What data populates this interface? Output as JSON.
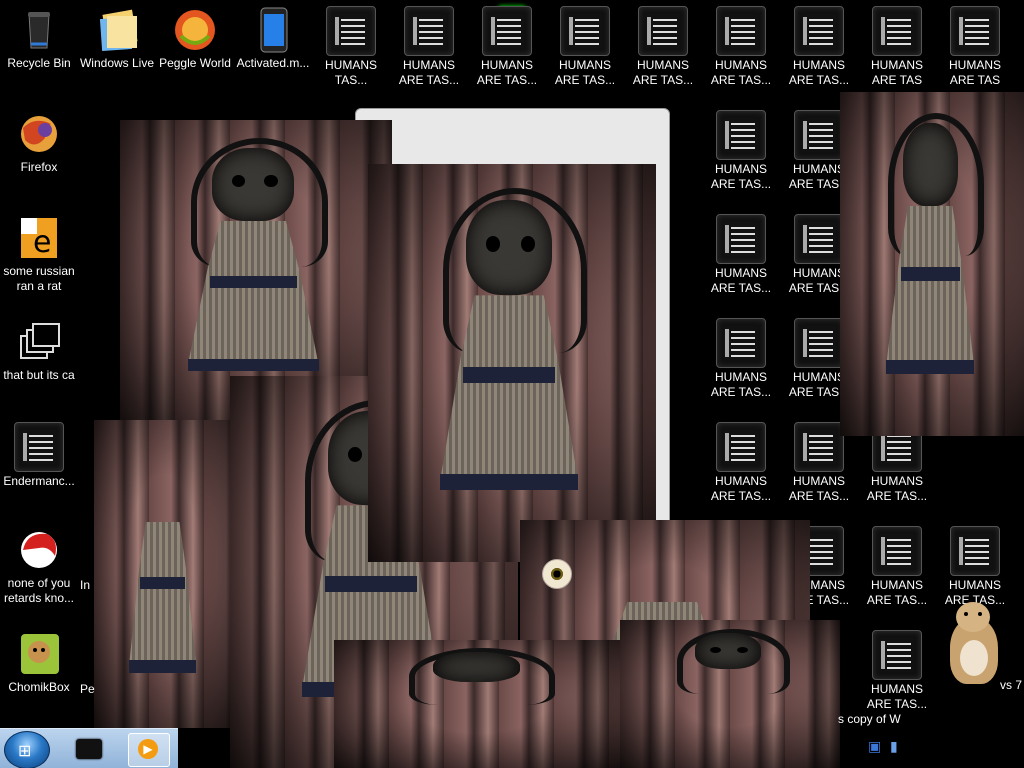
{
  "desktop": {
    "left_icons": [
      {
        "label": "Recycle Bin",
        "icon": "recycle-bin-icon"
      },
      {
        "label": "Firefox",
        "icon": "firefox-icon"
      },
      {
        "label": "some russian ran a rat",
        "icon": "shortcut-e-icon"
      },
      {
        "label": "that but its ca",
        "icon": "stacked-windows-icon"
      },
      {
        "label": "Endermanc...",
        "icon": "document-icon"
      },
      {
        "label": "none of you retards kno...",
        "icon": "firefox-red-icon"
      },
      {
        "label": "ChomikBox",
        "icon": "chomikbox-icon"
      }
    ],
    "top_icons": [
      {
        "label": "Windows Live",
        "icon": "folder-icon"
      },
      {
        "label": "Peggle World",
        "icon": "peggle-icon"
      },
      {
        "label": "Activated.m...",
        "icon": "blue-phone-icon"
      }
    ],
    "doc_label": "HUMANS ARE TAS...",
    "doc_label_short": "HUMANS ARE TAS",
    "doc_label_top_first": "HUMANS TAS...",
    "partial_labels": [
      "In",
      "Pe"
    ],
    "eyeball_icon": "eyeball-icon",
    "hamster_caption": "s copy of W",
    "hamster_caption_right": "vs 7"
  },
  "taskbar": {
    "start_label": "Start",
    "start_icon": "windows-orb-icon",
    "items": [
      {
        "name": "explorer",
        "icon": "explorer-icon"
      },
      {
        "name": "media-player",
        "icon": "media-player-icon"
      }
    ]
  },
  "tray": {
    "icons": [
      "network-icon",
      "flag-icon"
    ]
  },
  "colors": {
    "desktop": "#000000",
    "taskbar": "#9fbfe2",
    "indicator": "#10c050"
  }
}
